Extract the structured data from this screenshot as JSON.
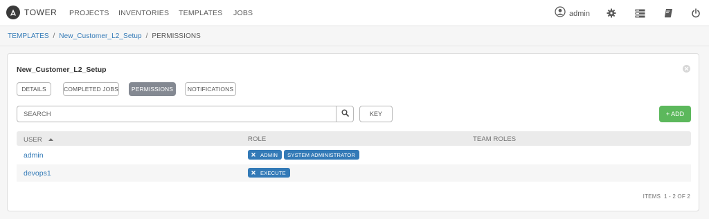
{
  "nav": {
    "brand": "TOWER",
    "links": [
      "PROJECTS",
      "INVENTORIES",
      "TEMPLATES",
      "JOBS"
    ],
    "user": "admin",
    "icons": [
      "user-icon",
      "gear-icon",
      "portal-icon",
      "docs-icon",
      "logout-icon"
    ]
  },
  "breadcrumb": {
    "root": "TEMPLATES",
    "item": "New_Customer_L2_Setup",
    "current": "PERMISSIONS",
    "separator": "/"
  },
  "panel": {
    "title": "New_Customer_L2_Setup",
    "tabs": [
      "DETAILS",
      "COMPLETED JOBS",
      "PERMISSIONS",
      "NOTIFICATIONS"
    ],
    "active_tab": "PERMISSIONS",
    "search": {
      "placeholder": "SEARCH",
      "value": ""
    },
    "key_label": "KEY",
    "add_label": "+ ADD"
  },
  "table": {
    "columns": [
      "USER",
      "ROLE",
      "TEAM ROLES"
    ],
    "sorted_by": "USER",
    "rows": [
      {
        "user": "admin",
        "roles": [
          "ADMIN",
          "SYSTEM ADMINISTRATOR"
        ],
        "removable_role": "ADMIN",
        "team_roles": ""
      },
      {
        "user": "devops1",
        "roles": [
          "EXECUTE"
        ],
        "removable_role": "EXECUTE",
        "team_roles": ""
      }
    ],
    "items_label": "ITEMS",
    "items_range": "1 - 2 OF 2"
  },
  "colors": {
    "link": "#337ab7",
    "chip": "#337ab7",
    "add_button": "#5cb85c",
    "active_tab": "#848992"
  }
}
